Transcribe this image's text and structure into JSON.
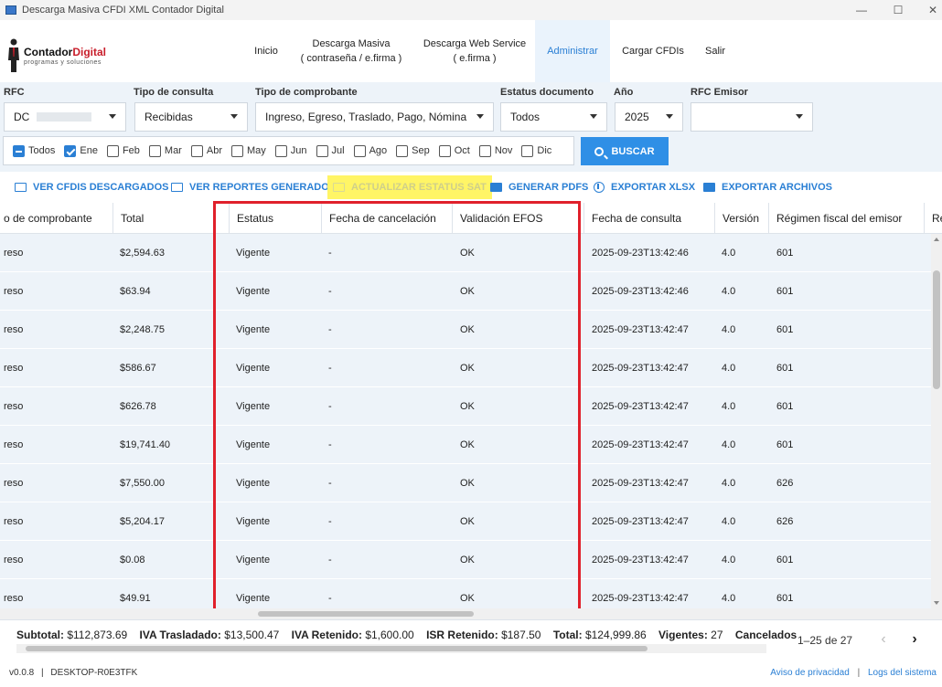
{
  "window": {
    "title": "Descarga Masiva CFDI XML Contador Digital",
    "min": "—",
    "max": "☐",
    "close": "✕"
  },
  "logo": {
    "brand_a": "Contador",
    "brand_b": "Digital",
    "tagline": "programas y soluciones"
  },
  "nav": [
    {
      "line1": "Inicio",
      "line2": ""
    },
    {
      "line1": "Descarga Masiva",
      "line2": "( contraseña / e.firma )"
    },
    {
      "line1": "Descarga Web Service",
      "line2": "( e.firma )"
    },
    {
      "line1": "Administrar",
      "line2": ""
    },
    {
      "line1": "Cargar CFDIs",
      "line2": ""
    },
    {
      "line1": "Salir",
      "line2": ""
    }
  ],
  "filters": {
    "rfc": {
      "label": "RFC",
      "value": "DC"
    },
    "tipo_consulta": {
      "label": "Tipo de consulta",
      "value": "Recibidas"
    },
    "tipo_comprobante": {
      "label": "Tipo de comprobante",
      "value": "Ingreso, Egreso, Traslado, Pago, Nómina"
    },
    "estatus": {
      "label": "Estatus documento",
      "value": "Todos"
    },
    "anio": {
      "label": "Año",
      "value": "2025"
    },
    "rfc_emisor": {
      "label": "RFC Emisor",
      "value": ""
    }
  },
  "months": [
    {
      "label": "Todos",
      "state": "partial"
    },
    {
      "label": "Ene",
      "state": "checked"
    },
    {
      "label": "Feb",
      "state": "unchecked"
    },
    {
      "label": "Mar",
      "state": "unchecked"
    },
    {
      "label": "Abr",
      "state": "unchecked"
    },
    {
      "label": "May",
      "state": "unchecked"
    },
    {
      "label": "Jun",
      "state": "unchecked"
    },
    {
      "label": "Jul",
      "state": "unchecked"
    },
    {
      "label": "Ago",
      "state": "unchecked"
    },
    {
      "label": "Sep",
      "state": "unchecked"
    },
    {
      "label": "Oct",
      "state": "unchecked"
    },
    {
      "label": "Nov",
      "state": "unchecked"
    },
    {
      "label": "Dic",
      "state": "unchecked"
    }
  ],
  "search_label": "BUSCAR",
  "toolbar": [
    {
      "label": "VER CFDIS DESCARGADOS",
      "icon": "folder-icon"
    },
    {
      "label": "VER REPORTES GENERADOS",
      "icon": "folder-icon"
    },
    {
      "label": "ACTUALIZAR ESTATUS SAT",
      "icon": "refresh-icon"
    },
    {
      "label": "GENERAR PDFS",
      "icon": "pdf-icon"
    },
    {
      "label": "EXPORTAR XLSX",
      "icon": "download-icon"
    },
    {
      "label": "EXPORTAR ARCHIVOS",
      "icon": "folder-upload-icon"
    }
  ],
  "table": {
    "columns": [
      "o de comprobante",
      "Total",
      "Estatus",
      "Fecha de cancelación",
      "Validación EFOS",
      "Fecha de consulta",
      "Versión",
      "Régimen fiscal del emisor",
      "Ré"
    ],
    "rows": [
      [
        "reso",
        "$2,594.63",
        "Vigente",
        "-",
        "OK",
        "2025-09-23T13:42:46",
        "4.0",
        "601"
      ],
      [
        "reso",
        "$63.94",
        "Vigente",
        "-",
        "OK",
        "2025-09-23T13:42:46",
        "4.0",
        "601"
      ],
      [
        "reso",
        "$2,248.75",
        "Vigente",
        "-",
        "OK",
        "2025-09-23T13:42:47",
        "4.0",
        "601"
      ],
      [
        "reso",
        "$586.67",
        "Vigente",
        "-",
        "OK",
        "2025-09-23T13:42:47",
        "4.0",
        "601"
      ],
      [
        "reso",
        "$626.78",
        "Vigente",
        "-",
        "OK",
        "2025-09-23T13:42:47",
        "4.0",
        "601"
      ],
      [
        "reso",
        "$19,741.40",
        "Vigente",
        "-",
        "OK",
        "2025-09-23T13:42:47",
        "4.0",
        "601"
      ],
      [
        "reso",
        "$7,550.00",
        "Vigente",
        "-",
        "OK",
        "2025-09-23T13:42:47",
        "4.0",
        "626"
      ],
      [
        "reso",
        "$5,204.17",
        "Vigente",
        "-",
        "OK",
        "2025-09-23T13:42:47",
        "4.0",
        "626"
      ],
      [
        "reso",
        "$0.08",
        "Vigente",
        "-",
        "OK",
        "2025-09-23T13:42:47",
        "4.0",
        "601"
      ],
      [
        "reso",
        "$49.91",
        "Vigente",
        "-",
        "OK",
        "2025-09-23T13:42:47",
        "4.0",
        "601"
      ]
    ]
  },
  "totals": {
    "subtotal_label": "Subtotal:",
    "subtotal": "$112,873.69",
    "iva_tras_label": "IVA Trasladado:",
    "iva_tras": "$13,500.47",
    "iva_ret_label": "IVA Retenido:",
    "iva_ret": "$1,600.00",
    "isr_ret_label": "ISR Retenido:",
    "isr_ret": "$187.50",
    "total_label": "Total:",
    "total": "$124,999.86",
    "vigentes_label": "Vigentes:",
    "vigentes": "27",
    "cancelados_label": "Cancelados"
  },
  "pager": {
    "range": "1–25 de 27",
    "prev": "‹",
    "next": "›"
  },
  "status": {
    "version": "v0.0.8",
    "sep": "|",
    "machine": "DESKTOP-R0E3TFK",
    "privacy": "Aviso de privacidad",
    "logs": "Logs del sistema"
  }
}
